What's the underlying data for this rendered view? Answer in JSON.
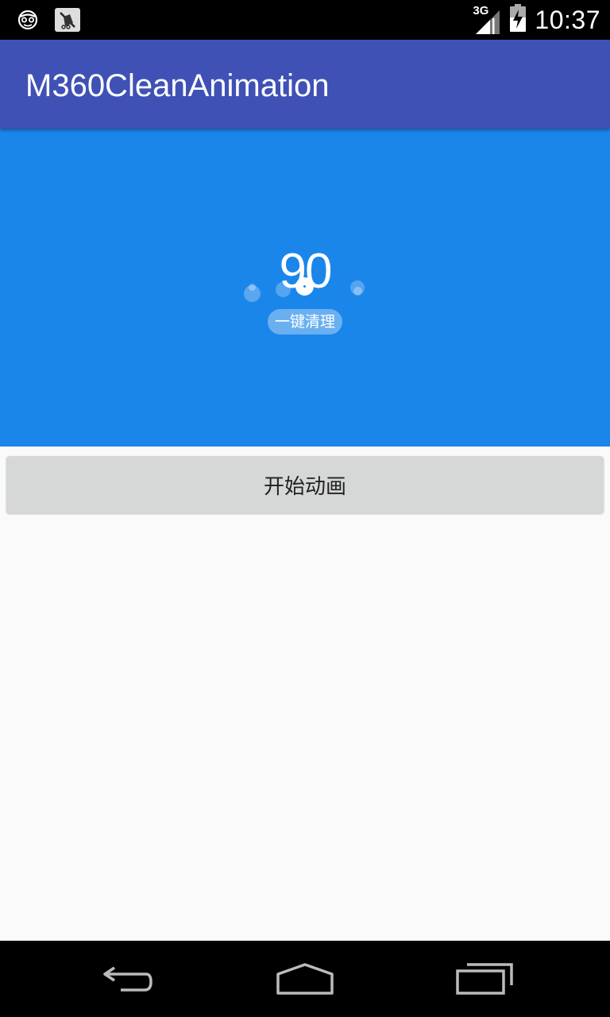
{
  "status_bar": {
    "time": "10:37",
    "network": "3G",
    "icons": [
      "incognito-face-icon",
      "mute-notification-icon",
      "signal-icon",
      "battery-charging-icon"
    ]
  },
  "app_bar": {
    "title": "M360CleanAnimation",
    "color": "#3f51b5"
  },
  "hero": {
    "background": "#1b86ea",
    "score": "90",
    "clean_label": "一键清理"
  },
  "action": {
    "start_label": "开始动画"
  },
  "nav": {
    "icons": [
      "back-icon",
      "home-icon",
      "recents-icon"
    ]
  }
}
